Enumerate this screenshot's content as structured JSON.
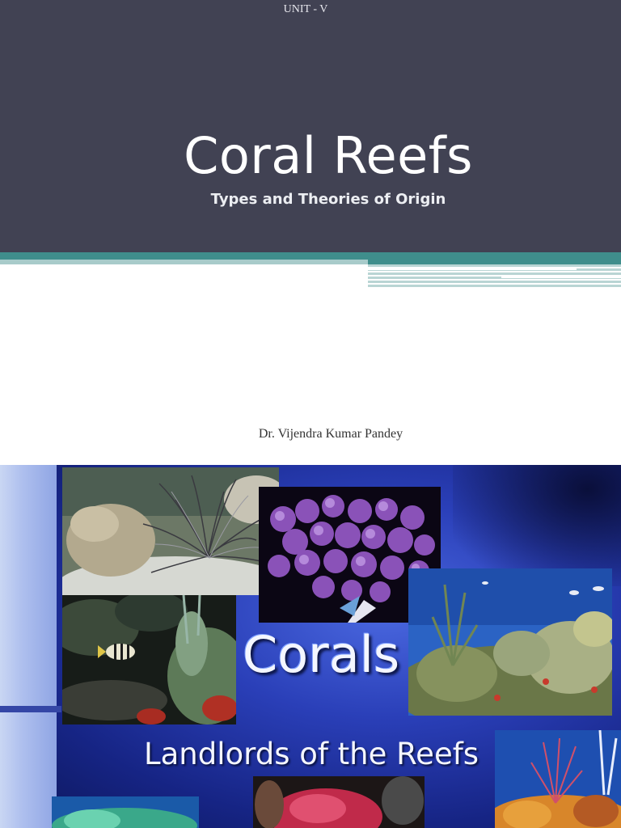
{
  "slide1": {
    "unit": "UNIT - V",
    "title": "Coral Reefs",
    "subtitle": "Types and Theories of Origin",
    "author": "Dr. Vijendra Kumar Pandey",
    "colors": {
      "title_panel": "#414253",
      "accent_teal": "#3f8e8c",
      "light_teal": "#9fc4c3"
    }
  },
  "slide2": {
    "title": "Corals",
    "subtitle": "Landlords of the Reefs",
    "photos": [
      "sea-anemone-photo",
      "purple-coral-photo",
      "reef-fish-photo",
      "reef-scene-photo",
      "gorgonian-photo",
      "bottom-left-coral-photo",
      "red-coral-photo"
    ]
  }
}
